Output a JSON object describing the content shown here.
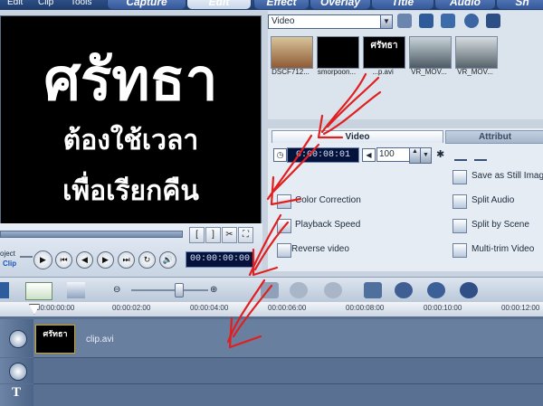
{
  "menu": {
    "edit": "Edit",
    "clip": "Clip",
    "tools": "Tools"
  },
  "tabs": {
    "capture": "Capture",
    "edit": "Edit",
    "effect": "Effect",
    "overlay": "Overlay",
    "title": "Title",
    "audio": "Audio",
    "share": "Sh"
  },
  "preview": {
    "line1": "ศรัทธา",
    "line2": "ต้องใช้เวลา",
    "line3": "เพื่อเรียกคืน"
  },
  "player": {
    "project_label": "oject",
    "clip_label": "Clip",
    "timecode": "00:00:00:00",
    "bracket_in": "[",
    "bracket_out": "]"
  },
  "library": {
    "folder": "Video",
    "items": [
      {
        "label": "DSCF712..."
      },
      {
        "label": "smorpoon..."
      },
      {
        "label": "...p.avi"
      },
      {
        "label": "VR_MOV..."
      },
      {
        "label": "VR_MOV..."
      }
    ]
  },
  "options_panel": {
    "tab_video": "Video",
    "tab_attribute": "Attribut",
    "duration": "0:00:08:01",
    "volume": "100",
    "items_left": [
      "Color Correction",
      "Playback Speed",
      "Reverse video"
    ],
    "items_right": [
      "Save as Still Imag",
      "Split Audio",
      "Split by Scene",
      "Multi-trim Video"
    ]
  },
  "ruler": {
    "ticks": [
      "00:00:00:00",
      "00:00:02:00",
      "00:00:04:00",
      "00:00:06:00",
      "00:00:08:00",
      "00:00:10:00",
      "00:00:12:00"
    ]
  },
  "timeline": {
    "clip_name": "clip.avi"
  },
  "colors": {
    "annotation_arrows": "#e02020",
    "timecode_bg": "#05123a"
  }
}
